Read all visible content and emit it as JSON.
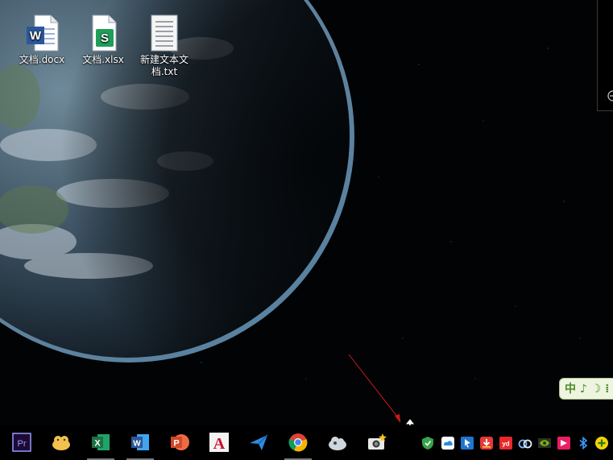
{
  "desktop": {
    "icons": [
      {
        "label": "文档.docx",
        "type": "word-document"
      },
      {
        "label": "文档.xlsx",
        "type": "spreadsheet-document"
      },
      {
        "label": "新建文本文档.txt",
        "type": "text-document"
      }
    ]
  },
  "ime": {
    "label": "中 ♪ ☽ ⁞"
  },
  "taskbar": {
    "pinned": [
      "premiere-pro-icon",
      "chat-bird-icon",
      "excel-icon",
      "word-icon",
      "powerpoint-icon",
      "autocad-icon",
      "send-arrow-icon",
      "chrome-icon",
      "cloud-app-icon",
      "camera-app-icon"
    ],
    "running": [
      "excel-icon",
      "word-icon",
      "chrome-icon"
    ],
    "tray": [
      "shield-icon",
      "cloud-sync-icon",
      "pin-icon",
      "download-icon",
      "youdao-icon",
      "network-share-icon",
      "nvidia-icon",
      "red-app-icon",
      "bluetooth-icon",
      "add-icon"
    ],
    "labels": {
      "premiere": "Pr",
      "excel": "X",
      "word": "W",
      "powerpoint": "P",
      "autocad": "A",
      "youdao": "yd"
    }
  },
  "colors": {
    "taskbar": "#000000",
    "premiere": "#9999ff",
    "excel": "#1e7145",
    "word": "#2b579a",
    "powerpoint": "#d24726",
    "autocad": "#c8102e"
  }
}
